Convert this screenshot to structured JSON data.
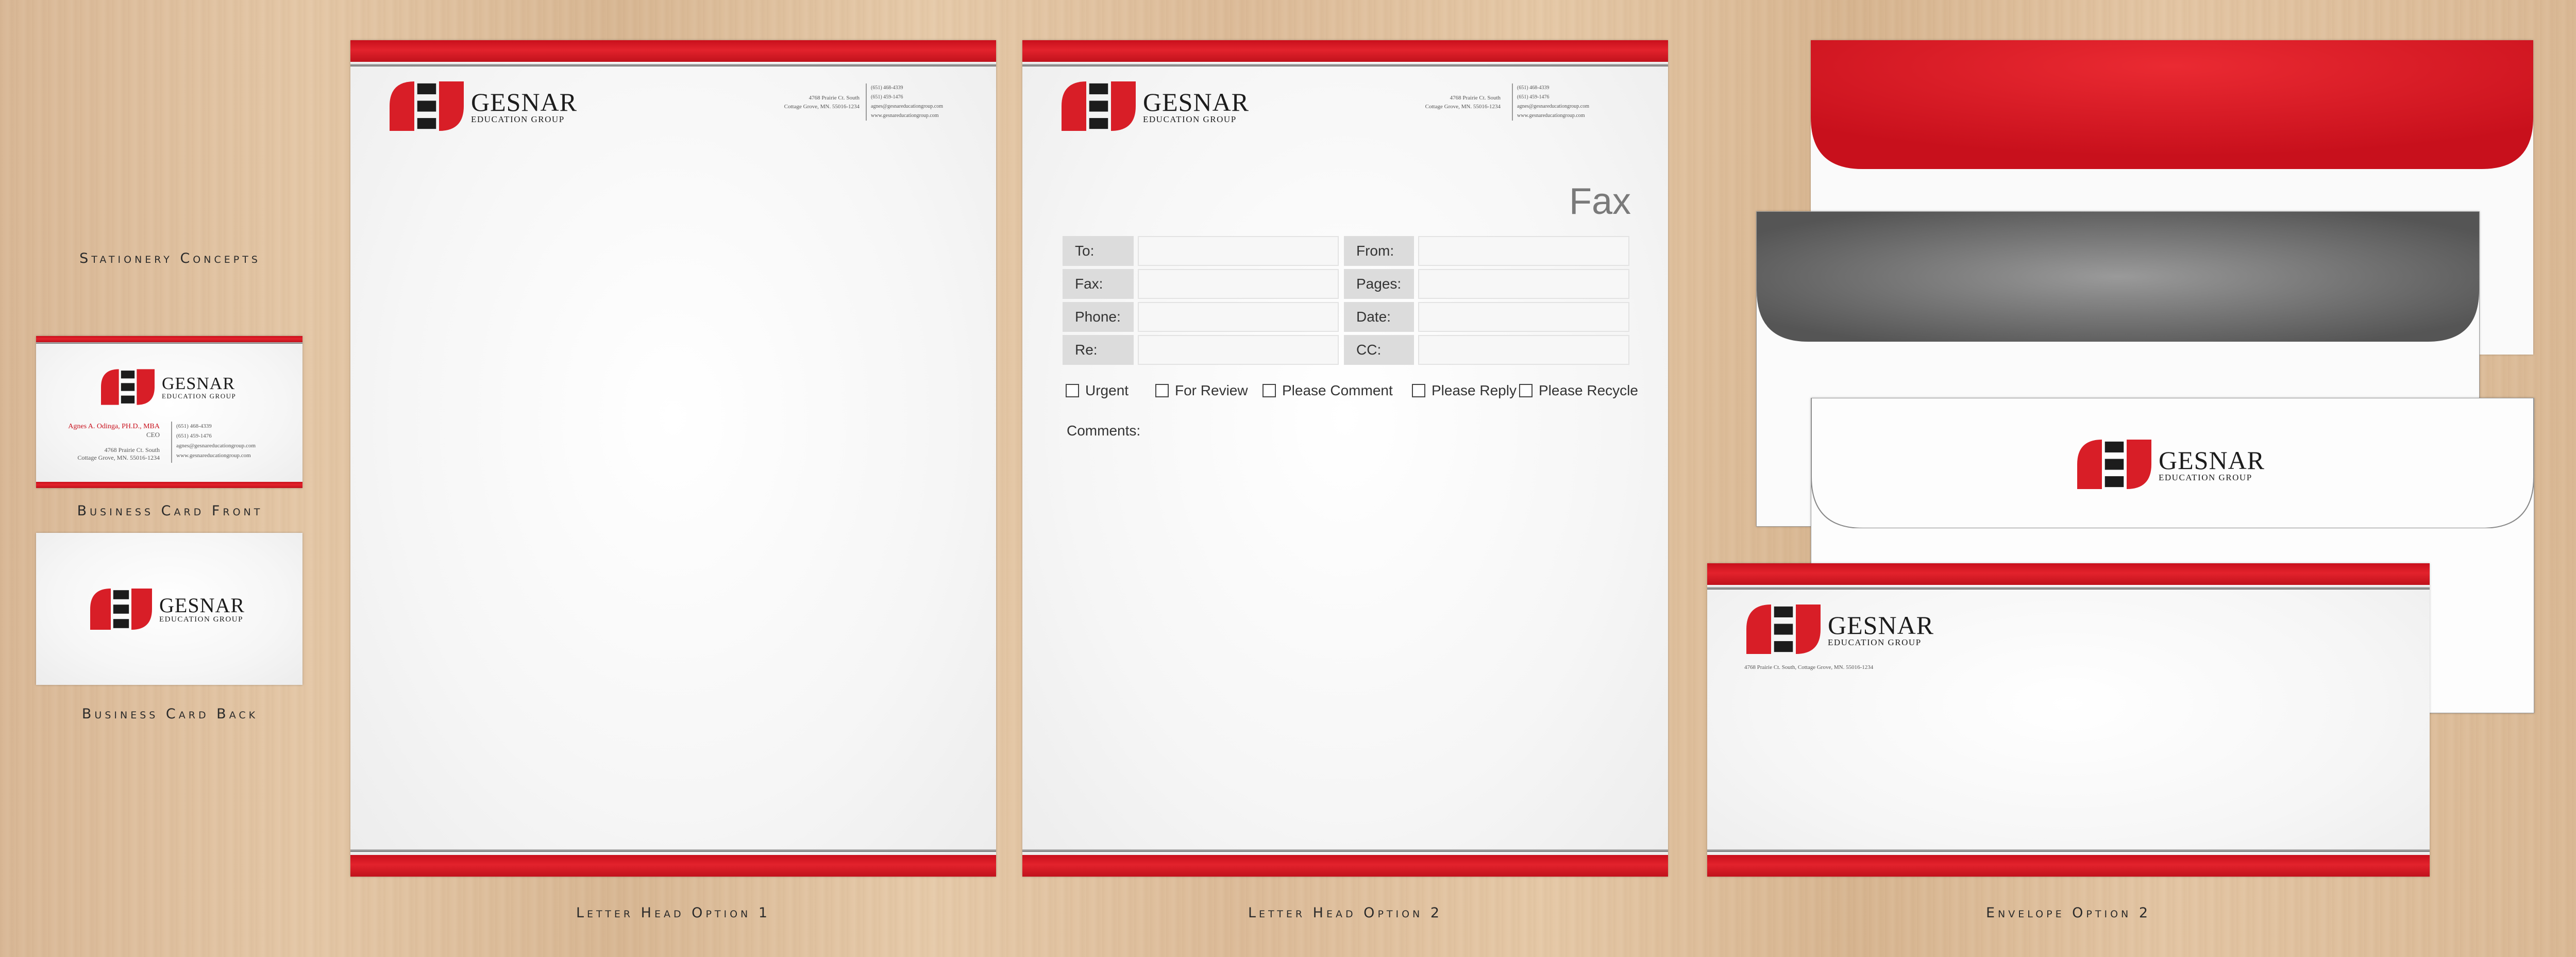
{
  "captions": {
    "stationery": "Stationery Concepts",
    "card_front": "Business Card Front",
    "card_back": "Business Card Back",
    "letterhead1": "Letter head Option 1",
    "letterhead2": "Letter head Option 2",
    "envelope": "Envelope Option 2"
  },
  "brand": {
    "name": "GESNAR",
    "subtitle": "EDUCATION GROUP",
    "red": "#d81e27",
    "dark": "#1c1c1c",
    "logo_icon": "gesnar-logo-icon"
  },
  "contact": {
    "address1": "4768 Prairie Ct. South",
    "address2": "Cottage Grove, MN. 55016-1234",
    "phone": "(651) 468-4339",
    "fax": "(651) 459-1476",
    "email": "agnes@gesnareducationgroup.com",
    "web": "www.gesnareducationgroup.com",
    "address_line": "4768 Prairie Ct. South, Cottage Grove, MN. 55016-1234"
  },
  "card": {
    "person_name": "Agnes A. Odinga",
    "credentials": "PH.D., MBA",
    "title": "CEO"
  },
  "fax": {
    "title": "Fax",
    "rows": [
      {
        "left": "To:",
        "right": "From:"
      },
      {
        "left": "Fax:",
        "right": "Pages:"
      },
      {
        "left": "Phone:",
        "right": "Date:"
      },
      {
        "left": "Re:",
        "right": "CC:"
      }
    ],
    "checks": [
      "Urgent",
      "For Review",
      "Please Comment",
      "Please Reply",
      "Please Recycle"
    ],
    "comments_label": "Comments:"
  }
}
